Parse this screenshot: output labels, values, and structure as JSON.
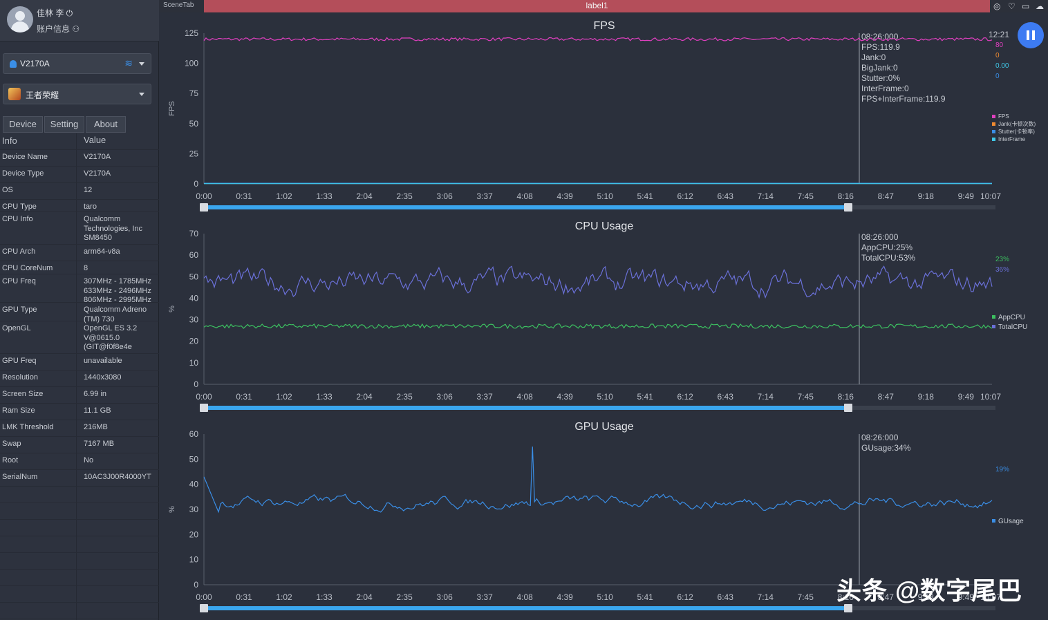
{
  "user": {
    "name": "佳林 李 ⏻",
    "account": "账户信息 ⚇"
  },
  "device_select": {
    "value": "V2170A"
  },
  "app_select": {
    "value": "王者荣耀"
  },
  "tabs": [
    "Device",
    "Setting",
    "About"
  ],
  "info_table": {
    "headers": [
      "Info",
      "Value"
    ],
    "rows": [
      {
        "k": "Device Name",
        "v": [
          "V2170A"
        ]
      },
      {
        "k": "Device Type",
        "v": [
          "V2170A"
        ]
      },
      {
        "k": "OS",
        "v": [
          "12"
        ]
      },
      {
        "k": "CPU Type",
        "v": [
          "taro"
        ]
      },
      {
        "k": "CPU Info",
        "v": [
          "Qualcomm",
          "Technologies, Inc",
          "SM8450"
        ]
      },
      {
        "k": "CPU Arch",
        "v": [
          "arm64-v8a"
        ]
      },
      {
        "k": "CPU CoreNum",
        "v": [
          "8"
        ]
      },
      {
        "k": "CPU Freq",
        "v": [
          "307MHz - 1785MHz",
          "633MHz - 2496MHz",
          "806MHz - 2995MHz"
        ]
      },
      {
        "k": "GPU Type",
        "v": [
          "Qualcomm Adreno",
          "(TM) 730"
        ]
      },
      {
        "k": "OpenGL",
        "v": [
          "OpenGL ES 3.2",
          "V@0615.0",
          "(GIT@f0f8e4e"
        ]
      },
      {
        "k": "GPU Freq",
        "v": [
          "unavailable"
        ]
      },
      {
        "k": "Resolution",
        "v": [
          "1440x3080"
        ]
      },
      {
        "k": "Screen Size",
        "v": [
          "6.99 in"
        ]
      },
      {
        "k": "Ram Size",
        "v": [
          "11.1 GB"
        ]
      },
      {
        "k": "LMK Threshold",
        "v": [
          "216MB"
        ]
      },
      {
        "k": "Swap",
        "v": [
          "7167 MB"
        ]
      },
      {
        "k": "Root",
        "v": [
          "No"
        ]
      },
      {
        "k": "SerialNum",
        "v": [
          "10AC3J00R4000YT"
        ]
      },
      {
        "k": "",
        "v": []
      },
      {
        "k": "",
        "v": []
      },
      {
        "k": "",
        "v": []
      },
      {
        "k": "",
        "v": []
      },
      {
        "k": "",
        "v": []
      },
      {
        "k": "",
        "v": []
      },
      {
        "k": "",
        "v": []
      },
      {
        "k": "",
        "v": []
      },
      {
        "k": "",
        "v": []
      }
    ]
  },
  "topbar": {
    "scene_tab": "SceneTab",
    "label": "label1"
  },
  "time_overlay": "12:21",
  "watermark": "头条 @数字尾巴",
  "colors": {
    "fps": "#e040c0",
    "jank": "#f08a30",
    "stutter": "#3a8ee6",
    "interframe": "#40c8e8",
    "appcpu": "#3cc060",
    "totalcpu": "#6a70d8",
    "gusage": "#3a8ee6",
    "accent": "#3d7bf2"
  },
  "chart_data": [
    {
      "type": "line",
      "title": "FPS",
      "ylabel": "FPS",
      "ylim": [
        0,
        125
      ],
      "yticks": [
        0,
        25,
        50,
        75,
        100,
        125
      ],
      "xticks": [
        "0:00",
        "0:31",
        "1:02",
        "1:33",
        "2:04",
        "2:35",
        "3:06",
        "3:37",
        "4:08",
        "4:39",
        "5:10",
        "5:41",
        "6:12",
        "6:43",
        "7:14",
        "7:45",
        "8:16",
        "8:47",
        "9:18",
        "9:49",
        "10:07"
      ],
      "cursor": {
        "x": "8:26",
        "lines": [
          "08:26:000",
          "FPS:119.9",
          "Jank:0",
          "BigJank:0",
          "Stutter:0%",
          "InterFrame:0",
          "FPS+InterFrame:119.9"
        ]
      },
      "current_values": [
        "80",
        "0",
        "0.00",
        "0"
      ],
      "legend": [
        "FPS",
        "Jank(卡顿次数)",
        "Stutter(卡顿率)",
        "InterFrame"
      ],
      "series": [
        {
          "name": "FPS",
          "approx": 119.9
        },
        {
          "name": "Jank",
          "approx": 0
        },
        {
          "name": "Stutter",
          "approx": 0
        },
        {
          "name": "InterFrame",
          "approx": 0
        }
      ]
    },
    {
      "type": "line",
      "title": "CPU Usage",
      "ylabel": "%",
      "ylim": [
        0,
        70
      ],
      "yticks": [
        0,
        10,
        20,
        30,
        40,
        50,
        60,
        70
      ],
      "xticks": [
        "0:00",
        "0:31",
        "1:02",
        "1:33",
        "2:04",
        "2:35",
        "3:06",
        "3:37",
        "4:08",
        "4:39",
        "5:10",
        "5:41",
        "6:12",
        "6:43",
        "7:14",
        "7:45",
        "8:16",
        "8:47",
        "9:18",
        "9:49",
        "10:07"
      ],
      "cursor": {
        "x": "8:26",
        "lines": [
          "08:26:000",
          "AppCPU:25%",
          "TotalCPU:53%"
        ]
      },
      "current_values": [
        "23%",
        "36%"
      ],
      "legend": [
        "AppCPU",
        "TotalCPU"
      ],
      "series": [
        {
          "name": "AppCPU",
          "approx": 27
        },
        {
          "name": "TotalCPU",
          "approx": 47
        }
      ]
    },
    {
      "type": "line",
      "title": "GPU Usage",
      "ylabel": "%",
      "ylim": [
        0,
        60
      ],
      "yticks": [
        0,
        10,
        20,
        30,
        40,
        50,
        60
      ],
      "xticks": [
        "0:00",
        "0:31",
        "1:02",
        "1:33",
        "2:04",
        "2:35",
        "3:06",
        "3:37",
        "4:08",
        "4:39",
        "5:10",
        "5:41",
        "6:12",
        "6:43",
        "7:14",
        "7:45",
        "8:16",
        "8:47",
        "9:18",
        "9:49",
        "10:07"
      ],
      "cursor": {
        "x": "8:26",
        "lines": [
          "08:26:000",
          "GUsage:34%"
        ]
      },
      "current_values": [
        "19%"
      ],
      "legend": [
        "GUsage"
      ],
      "series": [
        {
          "name": "GUsage",
          "approx": 33
        }
      ]
    }
  ]
}
